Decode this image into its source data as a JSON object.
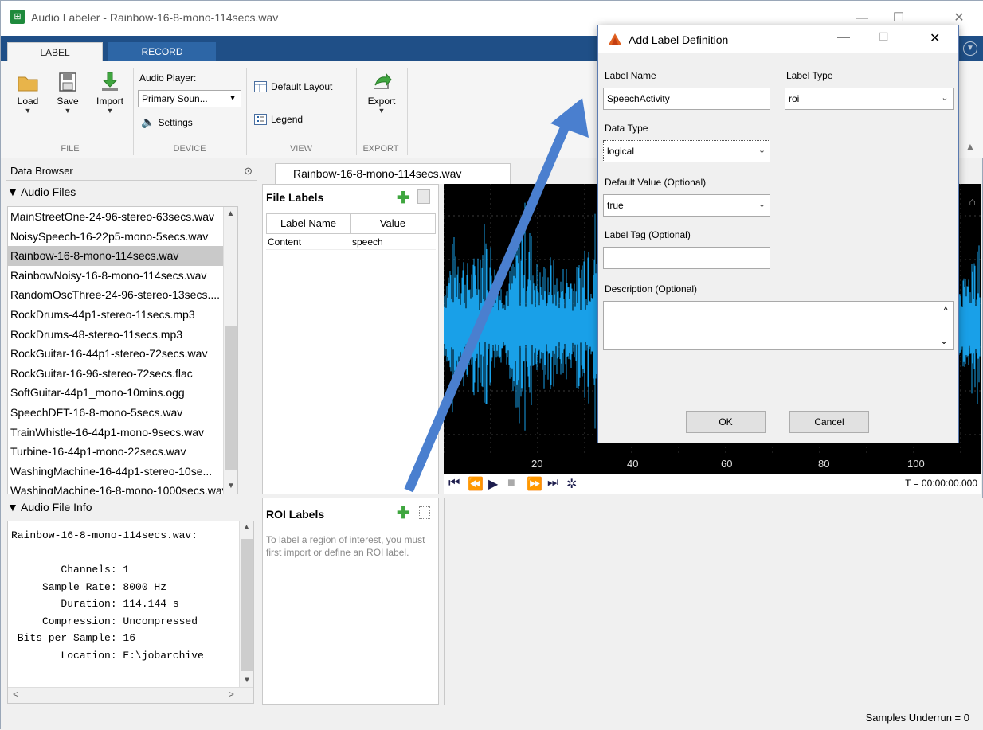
{
  "window": {
    "title": "Audio Labeler - Rainbow-16-8-mono-114secs.wav"
  },
  "tabs": {
    "label": "LABEL",
    "record": "RECORD"
  },
  "ribbon": {
    "file": {
      "load": "Load",
      "save": "Save",
      "import": "Import",
      "section": "FILE"
    },
    "device": {
      "player_label": "Audio Player:",
      "player_value": "Primary Soun...",
      "settings": "Settings",
      "section": "DEVICE"
    },
    "view": {
      "default_layout": "Default Layout",
      "legend": "Legend",
      "section": "VIEW"
    },
    "export": {
      "export": "Export",
      "section": "EXPORT"
    }
  },
  "data_browser": {
    "title": "Data Browser",
    "audio_files_header": "Audio Files",
    "files": [
      "MainStreetOne-24-96-stereo-63secs.wav",
      "NoisySpeech-16-22p5-mono-5secs.wav",
      "Rainbow-16-8-mono-114secs.wav",
      "RainbowNoisy-16-8-mono-114secs.wav",
      "RandomOscThree-24-96-stereo-13secs....",
      "RockDrums-44p1-stereo-11secs.mp3",
      "RockDrums-48-stereo-11secs.mp3",
      "RockGuitar-16-44p1-stereo-72secs.wav",
      "RockGuitar-16-96-stereo-72secs.flac",
      "SoftGuitar-44p1_mono-10mins.ogg",
      "SpeechDFT-16-8-mono-5secs.wav",
      "TrainWhistle-16-44p1-mono-9secs.wav",
      "Turbine-16-44p1-mono-22secs.wav",
      "WashingMachine-16-44p1-stereo-10se...",
      "WashingMachine-16-8-mono-1000secs.wav"
    ],
    "selected_index": 2,
    "file_info_header": "Audio File Info",
    "file_info_lines": [
      "Rainbow-16-8-mono-114secs.wav:",
      "",
      "        Channels: 1",
      "     Sample Rate: 8000 Hz",
      "        Duration: 114.144 s",
      "     Compression: Uncompressed",
      " Bits per Sample: 16",
      "        Location: E:\\jobarchive"
    ]
  },
  "doc_tab": "Rainbow-16-8-mono-114secs.wav",
  "file_labels": {
    "title": "File Labels",
    "columns": [
      "Label Name",
      "Value"
    ],
    "rows": [
      [
        "Content",
        "speech"
      ]
    ]
  },
  "roi_labels": {
    "title": "ROI Labels",
    "hint": "To label a region of interest, you must first import or define an ROI label."
  },
  "plot": {
    "x_ticks": [
      "20",
      "40",
      "60",
      "80",
      "100"
    ],
    "time_readout": "T = 00:00:00.000"
  },
  "status": {
    "underrun": "Samples Underrun = 0"
  },
  "dialog": {
    "title": "Add Label Definition",
    "label_name_label": "Label Name",
    "label_name_value": "SpeechActivity",
    "label_type_label": "Label Type",
    "label_type_value": "roi",
    "data_type_label": "Data Type",
    "data_type_value": "logical",
    "default_value_label": "Default Value (Optional)",
    "default_value_value": "true",
    "label_tag_label": "Label Tag (Optional)",
    "label_tag_value": "",
    "description_label": "Description (Optional)",
    "ok": "OK",
    "cancel": "Cancel"
  },
  "colors": {
    "accent": "#1f4f87",
    "waveform": "#19a0e8",
    "arrow": "#4a7fcf"
  }
}
